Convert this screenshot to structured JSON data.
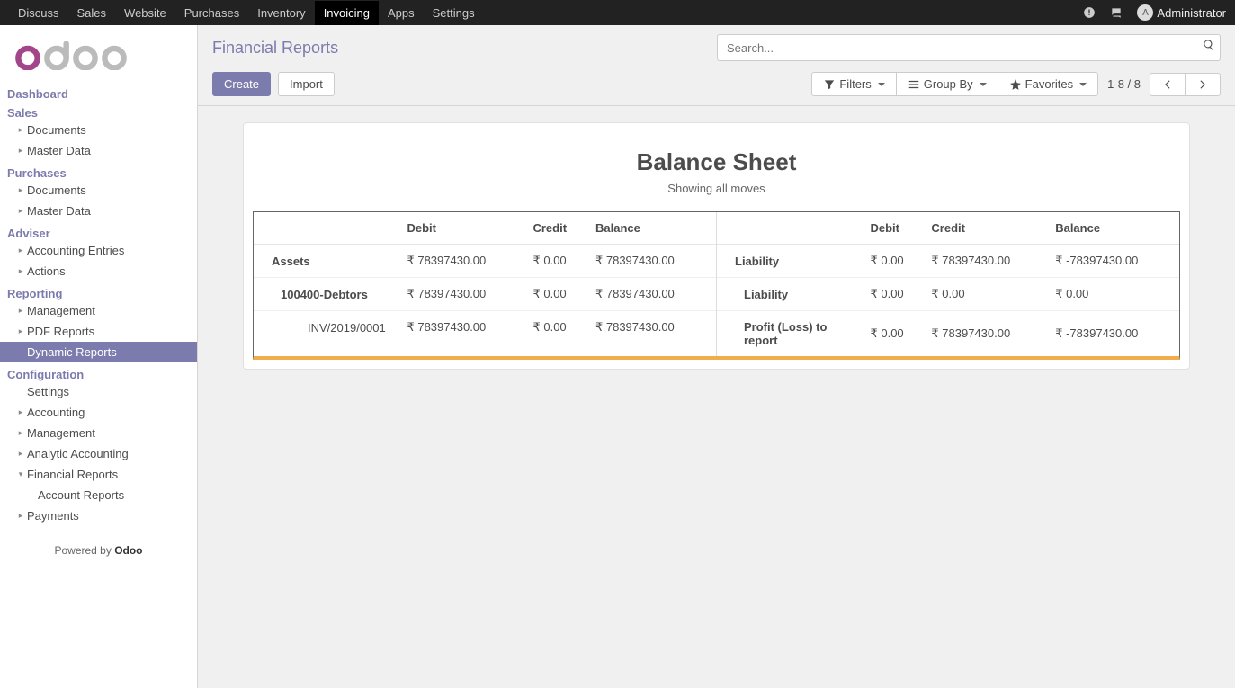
{
  "topnav": {
    "items": [
      "Discuss",
      "Sales",
      "Website",
      "Purchases",
      "Inventory",
      "Invoicing",
      "Apps",
      "Settings"
    ],
    "active_index": 5,
    "user": "Administrator"
  },
  "sidebar": {
    "sections": [
      {
        "header": "Dashboard",
        "items": []
      },
      {
        "header": "Sales",
        "items": [
          {
            "label": "Documents",
            "chev": true,
            "indent": 1
          },
          {
            "label": "Master Data",
            "chev": true,
            "indent": 1
          }
        ]
      },
      {
        "header": "Purchases",
        "items": [
          {
            "label": "Documents",
            "chev": true,
            "indent": 1
          },
          {
            "label": "Master Data",
            "chev": true,
            "indent": 1
          }
        ]
      },
      {
        "header": "Adviser",
        "items": [
          {
            "label": "Accounting Entries",
            "chev": true,
            "indent": 1
          },
          {
            "label": "Actions",
            "chev": true,
            "indent": 1
          }
        ]
      },
      {
        "header": "Reporting",
        "items": [
          {
            "label": "Management",
            "chev": true,
            "indent": 1
          },
          {
            "label": "PDF Reports",
            "chev": true,
            "indent": 1
          },
          {
            "label": "Dynamic Reports",
            "chev": false,
            "indent": 1,
            "active": true
          }
        ]
      },
      {
        "header": "Configuration",
        "items": [
          {
            "label": "Settings",
            "chev": false,
            "indent": 1
          },
          {
            "label": "Accounting",
            "chev": true,
            "indent": 1
          },
          {
            "label": "Management",
            "chev": true,
            "indent": 1
          },
          {
            "label": "Analytic Accounting",
            "chev": true,
            "indent": 1
          },
          {
            "label": "Financial Reports",
            "chev": true,
            "indent": 1,
            "expanded": true
          },
          {
            "label": "Account Reports",
            "chev": false,
            "indent": 2
          },
          {
            "label": "Payments",
            "chev": true,
            "indent": 1
          }
        ]
      }
    ],
    "powered_pre": "Powered by ",
    "powered_name": "Odoo"
  },
  "cp": {
    "breadcrumb": "Financial Reports",
    "search_placeholder": "Search...",
    "create": "Create",
    "import": "Import",
    "filters": "Filters",
    "groupby": "Group By",
    "favorites": "Favorites",
    "pager": "1-8 / 8"
  },
  "report": {
    "title": "Balance Sheet",
    "subtitle": "Showing all moves",
    "headers": {
      "debit": "Debit",
      "credit": "Credit",
      "balance": "Balance"
    },
    "left": [
      {
        "label": "Assets",
        "debit": "₹ 78397430.00",
        "credit": "₹ 0.00",
        "balance": "₹ 78397430.00",
        "bold": true,
        "pad": 1
      },
      {
        "label": "100400-Debtors",
        "debit": "₹ 78397430.00",
        "credit": "₹ 0.00",
        "balance": "₹ 78397430.00",
        "bold": true,
        "pad": 2
      },
      {
        "label": "INV/2019/0001",
        "debit": "₹ 78397430.00",
        "credit": "₹ 0.00",
        "balance": "₹ 78397430.00",
        "bold": false,
        "pad": 3
      }
    ],
    "right": [
      {
        "label": "Liability",
        "debit": "₹ 0.00",
        "credit": "₹ 78397430.00",
        "balance": "₹ -78397430.00",
        "bold": true,
        "pad": 1
      },
      {
        "label": "Liability",
        "debit": "₹ 0.00",
        "credit": "₹ 0.00",
        "balance": "₹ 0.00",
        "bold": true,
        "pad": 2
      },
      {
        "label": "Profit (Loss) to report",
        "debit": "₹ 0.00",
        "credit": "₹ 78397430.00",
        "balance": "₹ -78397430.00",
        "bold": true,
        "pad": 2
      }
    ]
  }
}
